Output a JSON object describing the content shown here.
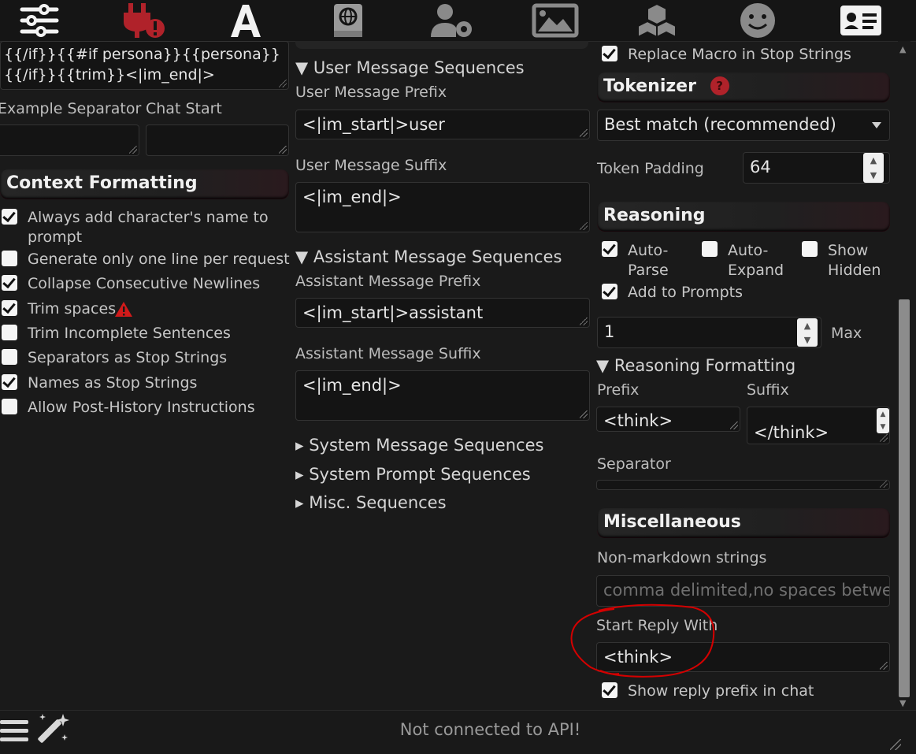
{
  "nav_icons": [
    "sliders-icon",
    "plug-warning-icon",
    "font-a-icon",
    "book-globe-icon",
    "user-gear-icon",
    "image-icon",
    "cubes-icon",
    "smiley-icon",
    "id-card-icon"
  ],
  "left": {
    "story_tail_line1": "{{/if}}{{#if persona}}{{persona}}",
    "story_tail_line2": "{{/if}}{{trim}}<|im_end|>",
    "example_separator_label": "Example Separator",
    "chat_start_label": "Chat Start",
    "context_formatting_header": "Context Formatting",
    "options": [
      {
        "label": "Always add character's name to prompt",
        "checked": true
      },
      {
        "label": "Generate only one line per request",
        "checked": false
      },
      {
        "label": "Collapse Consecutive Newlines",
        "checked": true
      },
      {
        "label": "Trim spaces",
        "checked": true
      },
      {
        "label": "Trim Incomplete Sentences",
        "checked": false
      },
      {
        "label": "Separators as Stop Strings",
        "checked": false
      },
      {
        "label": "Names as Stop Strings",
        "checked": true
      },
      {
        "label": "Allow Post-History Instructions",
        "checked": false
      }
    ]
  },
  "middle": {
    "user_seq_summary": "▼ User Message Sequences",
    "user_prefix_label": "User Message Prefix",
    "user_prefix_value": "<|im_start|>user",
    "user_suffix_label": "User Message Suffix",
    "user_suffix_value": "<|im_end|>",
    "assistant_seq_summary": "▼ Assistant Message Sequences",
    "assistant_prefix_label": "Assistant Message Prefix",
    "assistant_prefix_value": "<|im_start|>assistant",
    "assistant_suffix_label": "Assistant Message Suffix",
    "assistant_suffix_value": "<|im_end|>",
    "system_seq_summary": "▸ System Message Sequences",
    "system_prompt_seq_summary": "▸ System Prompt Sequences",
    "misc_seq_summary": "▸ Misc. Sequences"
  },
  "right": {
    "replace_macro_label": "Replace Macro in Stop Strings",
    "tokenizer_header": "Tokenizer",
    "tokenizer_help": "?",
    "tokenizer_value": "Best match (recommended)",
    "token_padding_label": "Token Padding",
    "token_padding_value": "64",
    "reasoning_header": "Reasoning",
    "auto_parse_label": "Auto-Parse",
    "auto_expand_label": "Auto-Expand",
    "show_hidden_label": "Show Hidden",
    "add_to_prompts_label": "Add to Prompts",
    "reasoning_count_value": "1",
    "max_label": "Max",
    "reasoning_formatting_summary": "▼  Reasoning Formatting",
    "prefix_label": "Prefix",
    "suffix_label": "Suffix",
    "prefix_value": "<think>",
    "suffix_value": "</think>",
    "separator_label": "Separator",
    "misc_header": "Miscellaneous",
    "non_markdown_label": "Non-markdown strings",
    "non_markdown_placeholder": "comma delimited,no spaces between",
    "start_reply_label": "Start Reply With",
    "start_reply_value": "<think>",
    "show_reply_prefix_label": "Show reply prefix in chat"
  },
  "status_text": "Not connected to API!",
  "colors": {
    "accent": "#b0222a",
    "annotation": "#d40000",
    "panel": "#1a1a1a"
  }
}
